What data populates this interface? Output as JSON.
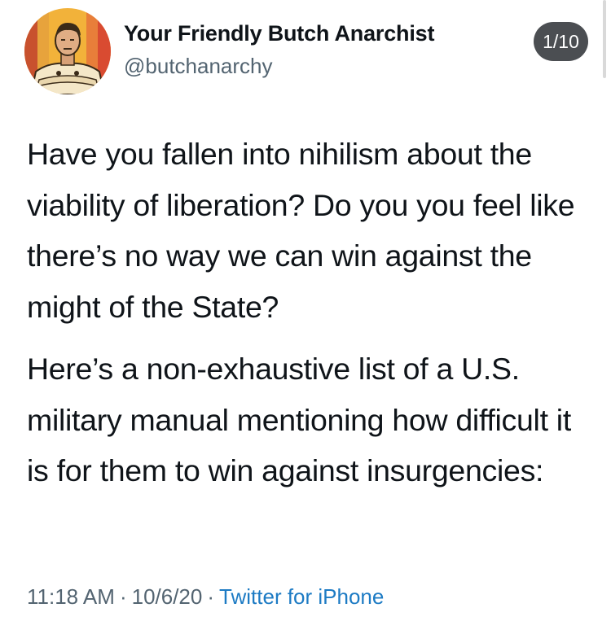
{
  "author": {
    "display_name": "Your Friendly Butch Anarchist",
    "handle": "@butchanarchy",
    "avatar_icon": "anarchist-portrait-avatar"
  },
  "thread_counter": "1/10",
  "tweet": {
    "paragraphs": [
      "Have you fallen into nihilism about the viability of liberation? Do you you feel like there’s no way we can win against the might of the State?",
      "Here’s a non-exhaustive list of a U.S. military manual mentioning how difficult it is for them to win against insurgencies:"
    ]
  },
  "meta": {
    "time": "11:18 AM",
    "separator": "·",
    "date": "10/6/20",
    "source": "Twitter for iPhone"
  },
  "colors": {
    "text": "#0f1419",
    "secondary": "#536471",
    "link": "#1d7bc4",
    "counter_bg": "#4b4e52"
  }
}
